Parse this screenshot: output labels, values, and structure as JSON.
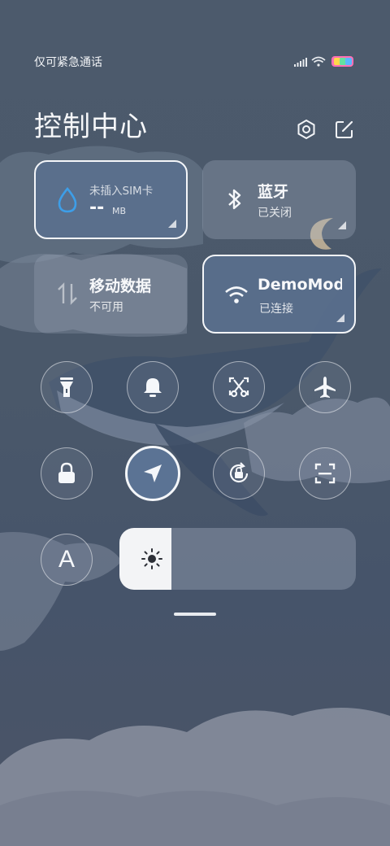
{
  "status_bar": {
    "carrier": "仅可紧急通话",
    "icons": [
      "signal-icon",
      "wifi-icon",
      "battery-icon"
    ],
    "battery_color": "#ff6fb5"
  },
  "header": {
    "title": "控制中心",
    "settings_icon": "settings-hexagon-icon",
    "edit_icon": "edit-icon"
  },
  "tiles": {
    "data_usage": {
      "label": "未插入SIM卡",
      "value": "--",
      "unit": "MB",
      "active": true,
      "icon": "water-drop-icon",
      "accent": "#3d9ee8"
    },
    "bluetooth": {
      "label": "蓝牙",
      "status": "已关闭",
      "active": false,
      "icon": "bluetooth-icon"
    },
    "mobile_data": {
      "label": "移动数据",
      "status": "不可用",
      "active": false,
      "icon": "mobile-data-arrows-icon"
    },
    "wifi": {
      "label": "DemoMod",
      "status": "已连接",
      "active": true,
      "icon": "wifi-icon"
    }
  },
  "toggles_row1": [
    {
      "name": "flashlight",
      "icon": "flashlight-icon",
      "active": false
    },
    {
      "name": "ringer",
      "icon": "bell-icon",
      "active": false
    },
    {
      "name": "screenshot",
      "icon": "scissors-screenshot-icon",
      "active": false
    },
    {
      "name": "airplane-mode",
      "icon": "airplane-icon",
      "active": false
    }
  ],
  "toggles_row2": [
    {
      "name": "lock-screen",
      "icon": "lock-icon",
      "active": false
    },
    {
      "name": "location",
      "icon": "location-arrow-icon",
      "active": true
    },
    {
      "name": "rotation-lock",
      "icon": "rotation-lock-icon",
      "active": false
    },
    {
      "name": "scanner",
      "icon": "scan-frame-icon",
      "active": false
    }
  ],
  "auto_brightness": {
    "icon": "letter-a-icon",
    "label": "A"
  },
  "brightness": {
    "level": 0.22,
    "icon": "sun-icon"
  },
  "colors": {
    "active_tile": "#5a708e",
    "accent_blue": "#3d9ee8",
    "background": "#4c5a6c"
  }
}
